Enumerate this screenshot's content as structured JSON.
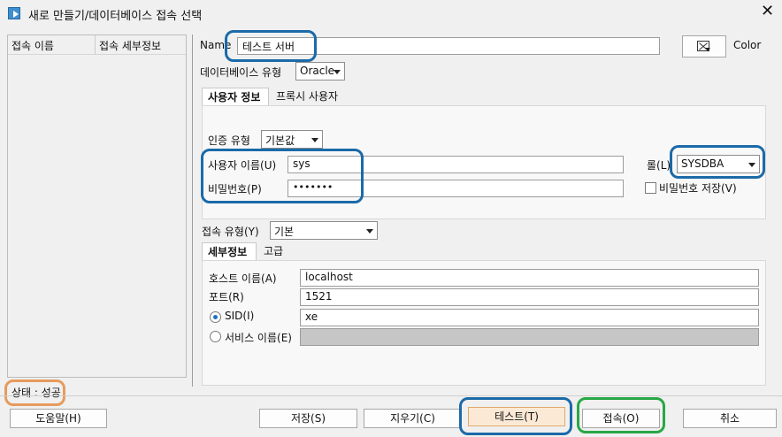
{
  "window": {
    "title": "새로 만들기/데이터베이스 접속 선택",
    "close": "✕"
  },
  "connections": {
    "col_name": "접속 이름",
    "col_detail": "접속 세부정보"
  },
  "form": {
    "name_label": "Name",
    "name_value": "테스트 서버",
    "color_label": "Color",
    "db_type_label": "데이터베이스 유형",
    "db_type_value": "Oracle",
    "tabs": [
      "사용자 정보",
      "프록시 사용자"
    ],
    "auth_type_label": "인증 유형",
    "auth_type_value": "기본값",
    "username_label": "사용자 이름(U)",
    "username_value": "sys",
    "password_label": "비밀번호(P)",
    "password_value": "•••••••",
    "role_label": "롤(L)",
    "role_value": "SYSDBA",
    "save_password_label": "비밀번호 저장(V)",
    "conn_type_label": "접속 유형(Y)",
    "conn_type_value": "기본",
    "detail_tabs": [
      "세부정보",
      "고급"
    ],
    "host_label": "호스트 이름(A)",
    "host_value": "localhost",
    "port_label": "포트(R)",
    "port_value": "1521",
    "sid_label": "SID(I)",
    "sid_value": "xe",
    "service_label": "서비스 이름(E)",
    "service_value": ""
  },
  "status": {
    "text": "상태 : 성공"
  },
  "buttons": {
    "help": "도움말(H)",
    "save": "저장(S)",
    "clear": "지우기(C)",
    "test": "테스트(T)",
    "connect": "접속(O)",
    "cancel": "취소"
  }
}
